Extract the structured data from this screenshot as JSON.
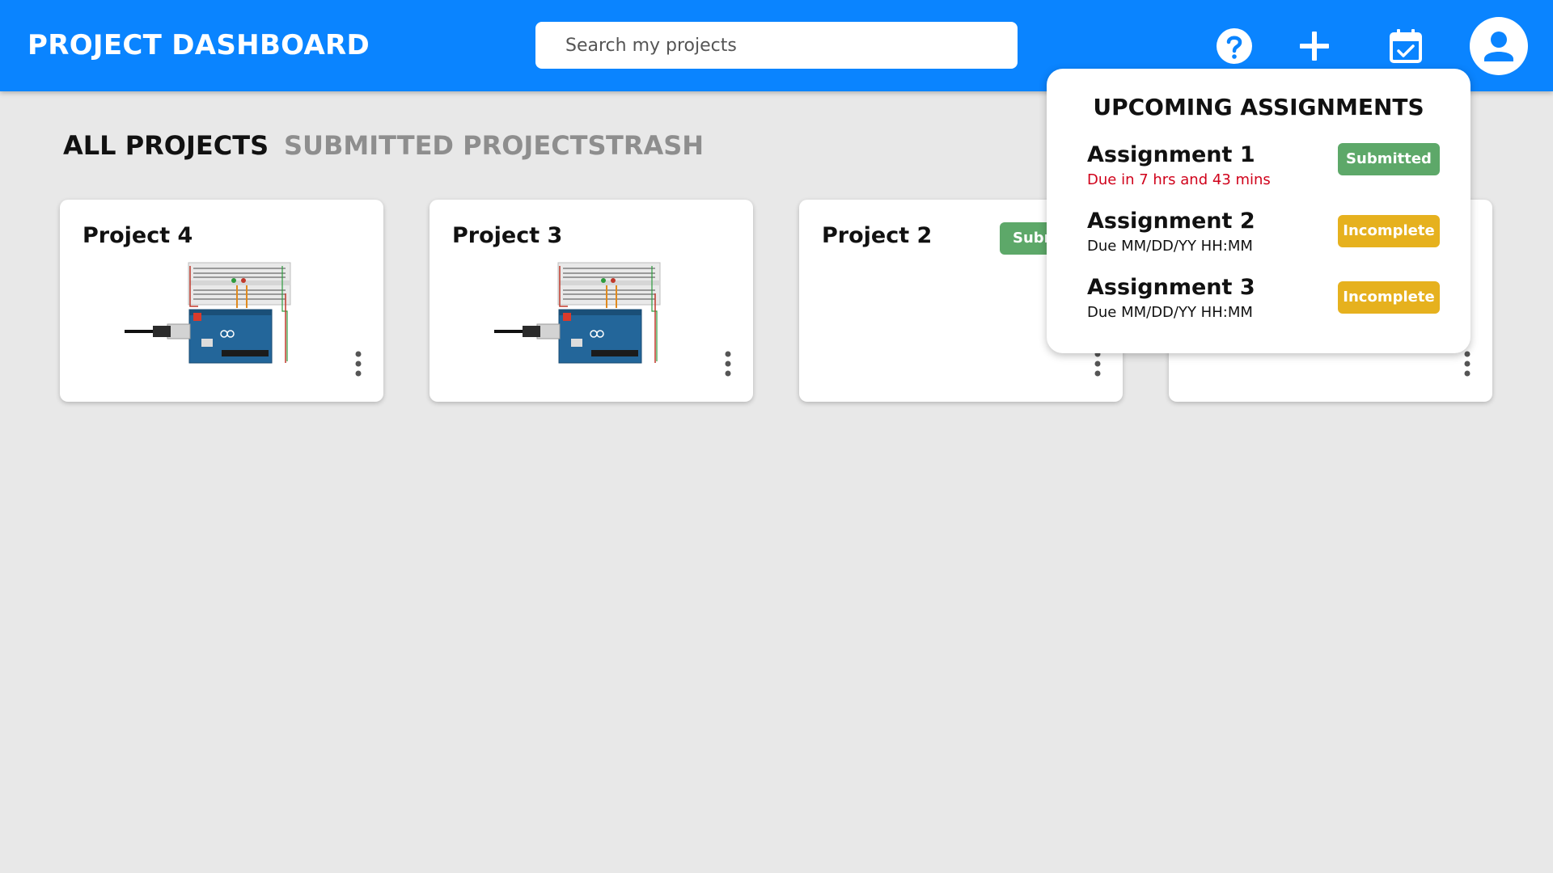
{
  "header": {
    "title": "PROJECT DASHBOARD",
    "search_placeholder": "Search my projects",
    "icons": [
      "help-icon",
      "plus-icon",
      "calendar-check-icon",
      "user-avatar-icon"
    ],
    "bar_color": "#0a84ff"
  },
  "tabs": [
    {
      "label": "ALL PROJECTS",
      "active": true
    },
    {
      "label": "SUBMITTED PROJECTS",
      "active": false
    },
    {
      "label": "TRASH",
      "active": false
    }
  ],
  "projects": [
    {
      "title": "Project 4",
      "thumbnail": "arduino-breadboard",
      "badge": ""
    },
    {
      "title": "Project 3",
      "thumbnail": "arduino-breadboard",
      "badge": ""
    },
    {
      "title": "Project 2",
      "thumbnail": "",
      "badge": "Subm"
    },
    {
      "title": "",
      "thumbnail": "",
      "badge": ""
    }
  ],
  "popup": {
    "title": "UPCOMING ASSIGNMENTS",
    "assignments": [
      {
        "name": "Assignment 1",
        "due": "Due in 7 hrs and 43 mins",
        "status": "Submitted",
        "due_color": "#d0021b"
      },
      {
        "name": "Assignment 2",
        "due": "Due MM/DD/YY HH:MM",
        "status": "Incomplete",
        "due_color": "#111111"
      },
      {
        "name": "Assignment 3",
        "due": "Due MM/DD/YY HH:MM",
        "status": "Incomplete",
        "due_color": "#111111"
      }
    ],
    "status_colors": {
      "Submitted": "#5da869",
      "Incomplete": "#e6b11e"
    }
  }
}
